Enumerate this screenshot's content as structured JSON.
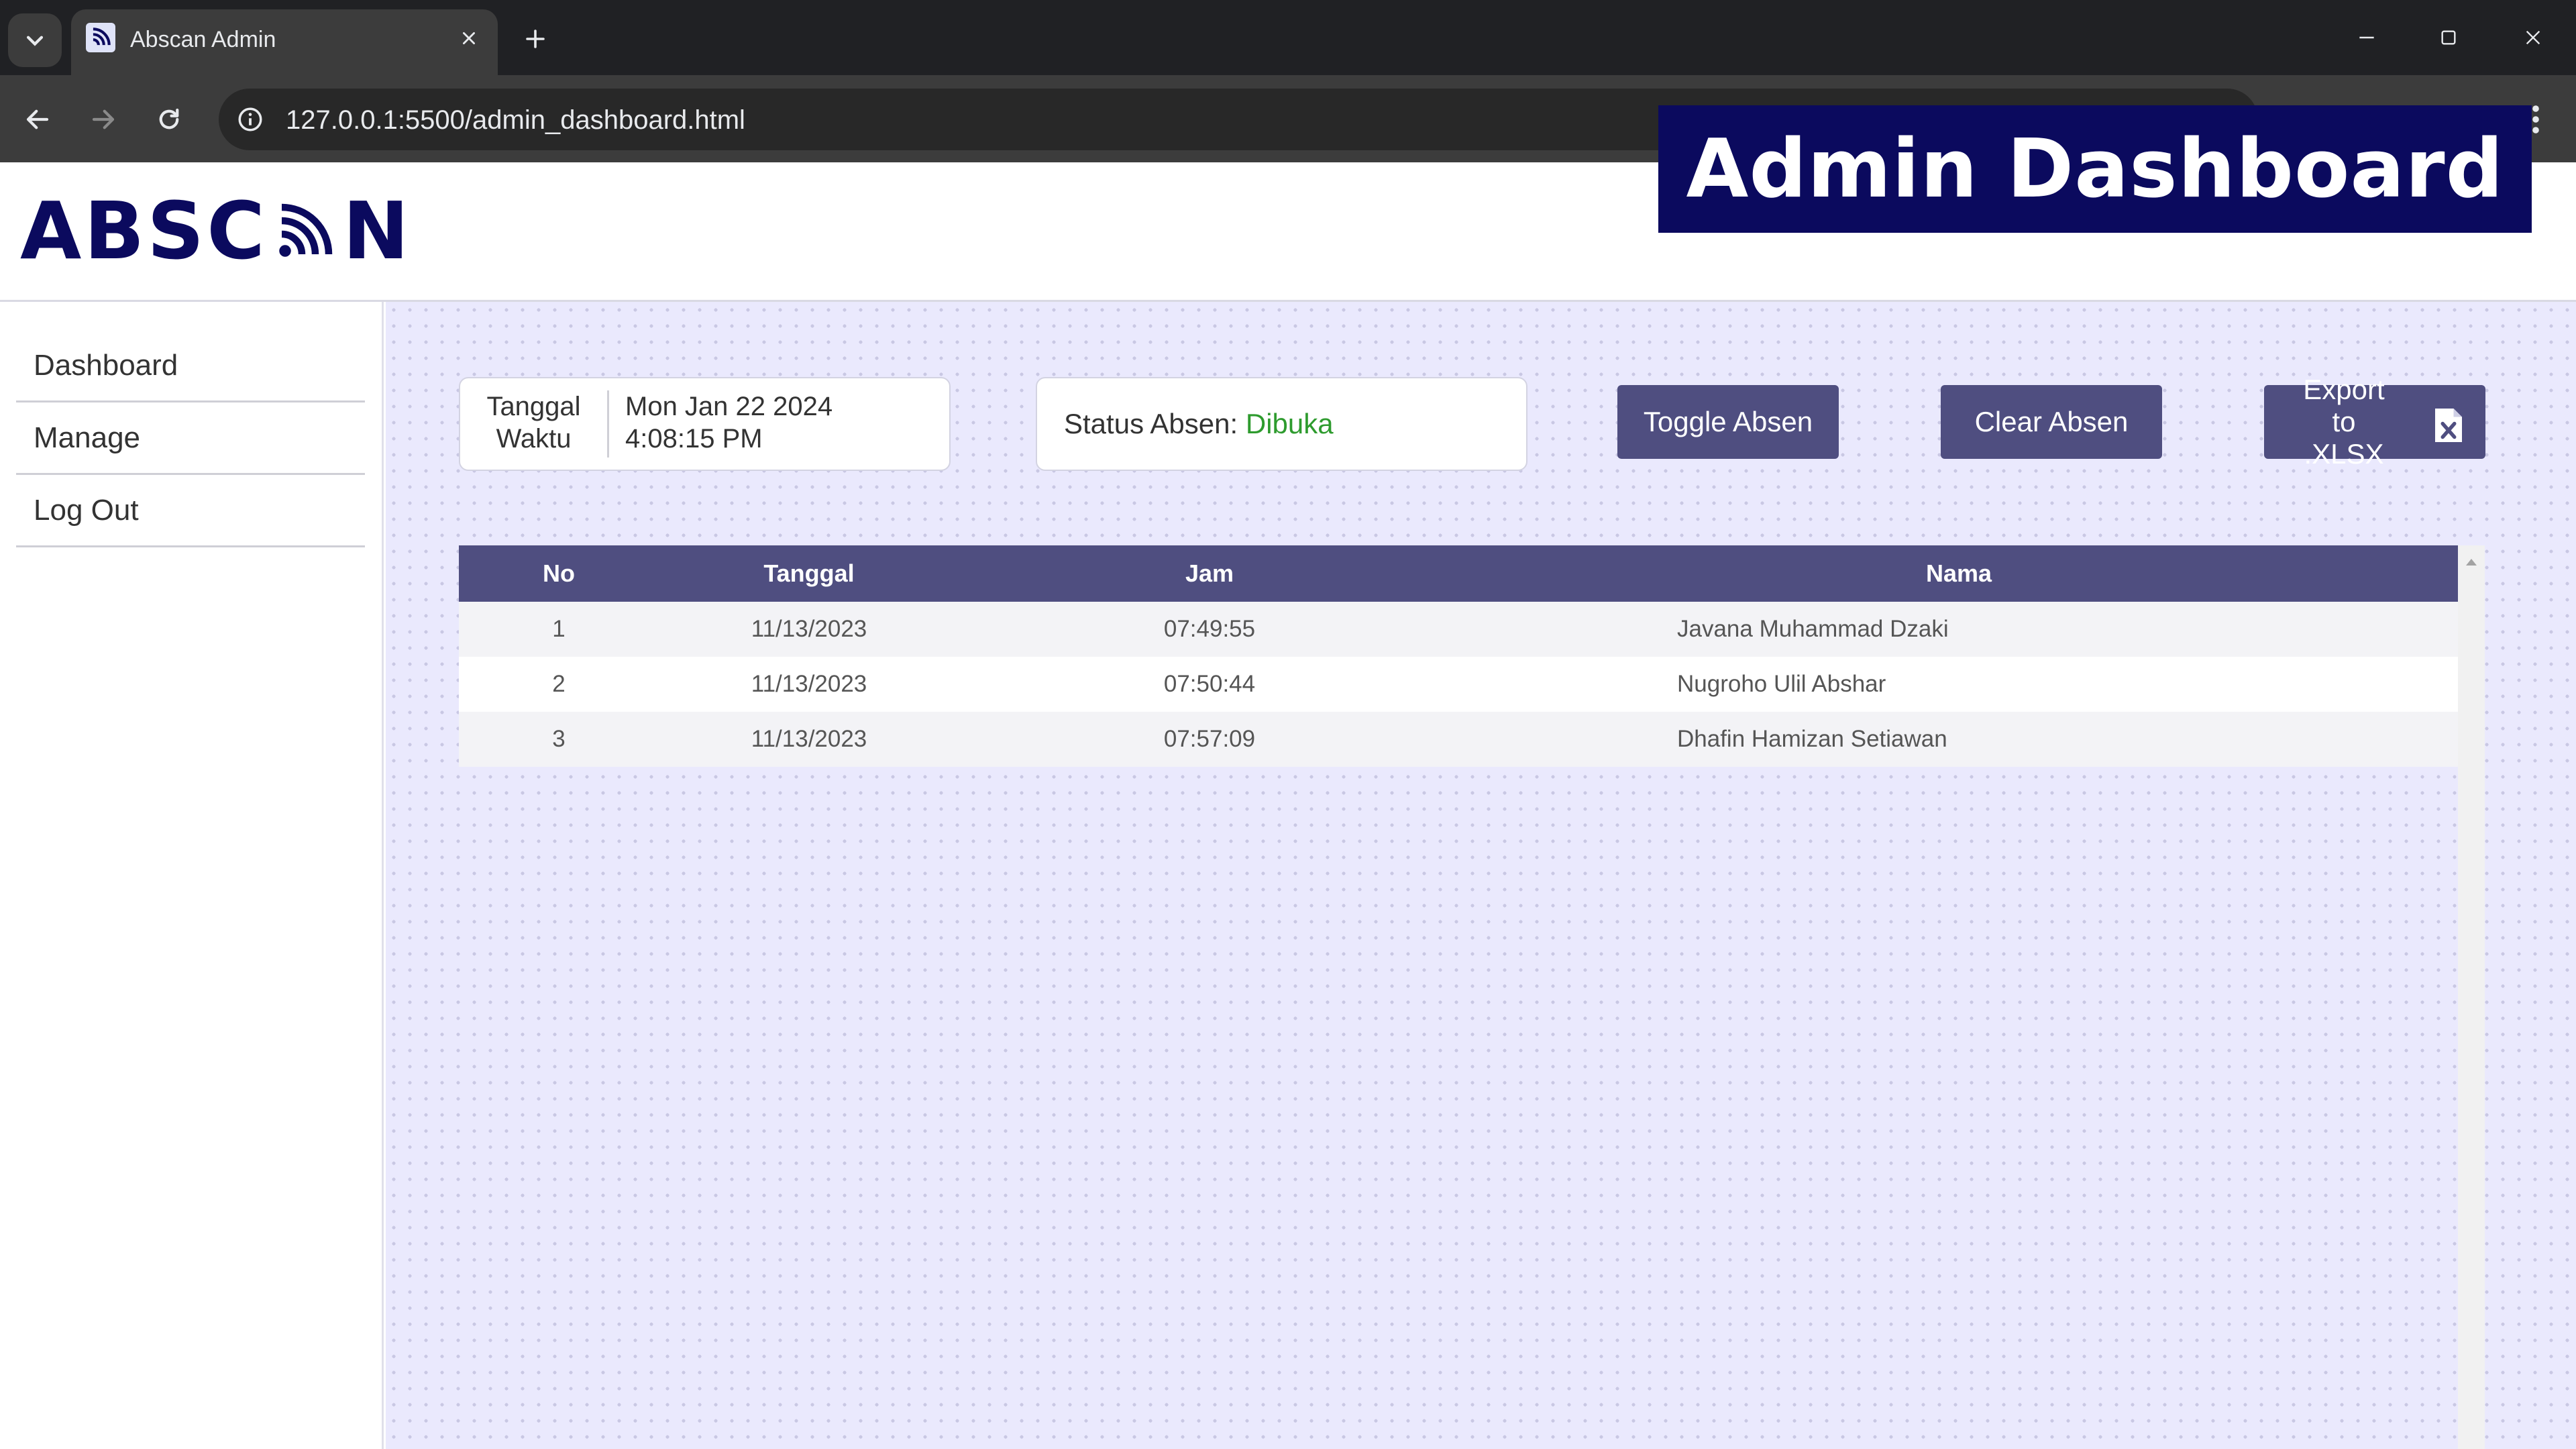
{
  "browser": {
    "tab_title": "Abscan Admin",
    "url": "127.0.0.1:5500/admin_dashboard.html"
  },
  "overlay": {
    "title": "Admin Dashboard"
  },
  "header": {
    "logo_text_left": "ABSC",
    "logo_text_right": "N"
  },
  "sidebar": {
    "items": [
      {
        "label": "Dashboard"
      },
      {
        "label": "Manage"
      },
      {
        "label": "Log Out"
      }
    ]
  },
  "datetime": {
    "label_date": "Tanggal",
    "label_time": "Waktu",
    "date": "Mon Jan 22 2024",
    "time": "4:08:15 PM"
  },
  "status": {
    "label": "Status Absen:",
    "value": "Dibuka",
    "value_color": "#2e9b2e"
  },
  "buttons": {
    "toggle": "Toggle Absen",
    "clear": "Clear Absen",
    "export_line1": "Export to",
    "export_line2": ".XLSX"
  },
  "table": {
    "headers": {
      "no": "No",
      "tanggal": "Tanggal",
      "jam": "Jam",
      "nama": "Nama"
    },
    "rows": [
      {
        "no": "1",
        "tanggal": "11/13/2023",
        "jam": "07:49:55",
        "nama": "Javana Muhammad Dzaki"
      },
      {
        "no": "2",
        "tanggal": "11/13/2023",
        "jam": "07:50:44",
        "nama": "Nugroho Ulil Abshar"
      },
      {
        "no": "3",
        "tanggal": "11/13/2023",
        "jam": "07:57:09",
        "nama": "Dhafin Hamizan Setiawan"
      }
    ]
  },
  "colors": {
    "brand_navy": "#0b0a5e",
    "accent_purple": "#4f4e80",
    "main_bg": "#eae9fd"
  },
  "icons": [
    "tab-list-icon",
    "favicon-icon",
    "close-icon",
    "plus-icon",
    "minimize-icon",
    "maximize-icon",
    "window-close-icon",
    "back-icon",
    "forward-icon",
    "reload-icon",
    "info-icon",
    "more-vert-icon",
    "signal-wave-icon",
    "excel-file-icon"
  ]
}
